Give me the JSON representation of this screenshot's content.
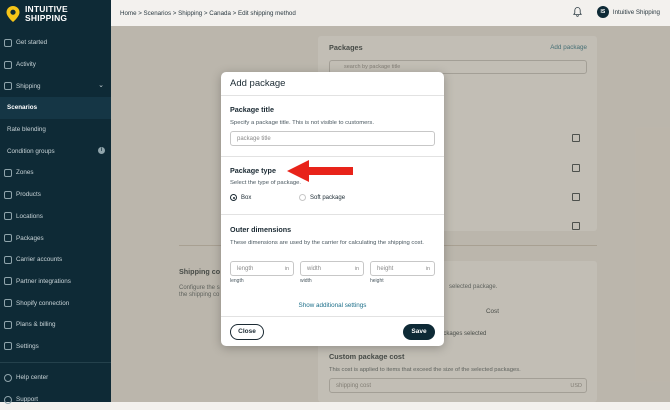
{
  "brand": {
    "name_line1": "INTUITIVE",
    "name_line2": "SHIPPING",
    "accent": "#f5c518"
  },
  "sidebar": {
    "items": [
      {
        "label": "Get started",
        "icon": "rocket-icon"
      },
      {
        "label": "Activity",
        "icon": "activity-icon"
      },
      {
        "label": "Shipping",
        "icon": "truck-icon",
        "chevron": "⌄"
      },
      {
        "label": "Scenarios",
        "sub": true,
        "active": true
      },
      {
        "label": "Rate blending",
        "sub": true
      },
      {
        "label": "Condition groups",
        "sub": true,
        "badge": "i"
      },
      {
        "label": "Zones",
        "icon": "globe-icon"
      },
      {
        "label": "Products",
        "icon": "tag-icon"
      },
      {
        "label": "Locations",
        "icon": "warehouse-icon"
      },
      {
        "label": "Packages",
        "icon": "package-icon"
      },
      {
        "label": "Carrier accounts",
        "icon": "truck-icon"
      },
      {
        "label": "Partner integrations",
        "icon": "plug-icon"
      },
      {
        "label": "Shopify connection",
        "icon": "link-icon"
      },
      {
        "label": "Plans & billing",
        "icon": "card-icon"
      },
      {
        "label": "Settings",
        "icon": "gear-icon"
      }
    ],
    "footer": [
      {
        "label": "Help center",
        "icon": "help-icon"
      },
      {
        "label": "Support",
        "icon": "support-icon"
      }
    ]
  },
  "header": {
    "breadcrumb": "Home > Scenarios > Shipping > Canada > Edit shipping method",
    "user_initials": "IS",
    "user_name": "Intuitive Shipping"
  },
  "background": {
    "packages_title": "Packages",
    "add_package_link": "Add package",
    "search_placeholder": "search by package title",
    "shipping_cost_title": "Shipping co",
    "shipping_cost_desc1": "Configure the s",
    "shipping_cost_desc2": "the shipping co",
    "selected_package_text": "selected package.",
    "cost_header": "Cost",
    "packages_selected_text": "ackages selected",
    "custom_cost_title": "Custom package cost",
    "custom_cost_desc": "This cost is applied to items that exceed the size of the selected packages.",
    "shipping_cost_placeholder": "shipping cost",
    "currency": "USD"
  },
  "modal": {
    "title": "Add package",
    "package_title": {
      "heading": "Package title",
      "description": "Specify a package title. This is not visible to customers.",
      "placeholder": "package title"
    },
    "package_type": {
      "heading": "Package type",
      "description": "Select the type of package.",
      "options": [
        {
          "label": "Box",
          "selected": true
        },
        {
          "label": "Soft package",
          "selected": false
        }
      ]
    },
    "outer_dimensions": {
      "heading": "Outer dimensions",
      "description": "These dimensions are used by the carrier for calculating the shipping cost.",
      "fields": [
        {
          "placeholder": "length",
          "unit": "in",
          "label": "length"
        },
        {
          "placeholder": "width",
          "unit": "in",
          "label": "width"
        },
        {
          "placeholder": "height",
          "unit": "in",
          "label": "height"
        }
      ]
    },
    "show_more": "Show additional settings",
    "close_label": "Close",
    "save_label": "Save"
  },
  "annotation_color": "#e8231a"
}
